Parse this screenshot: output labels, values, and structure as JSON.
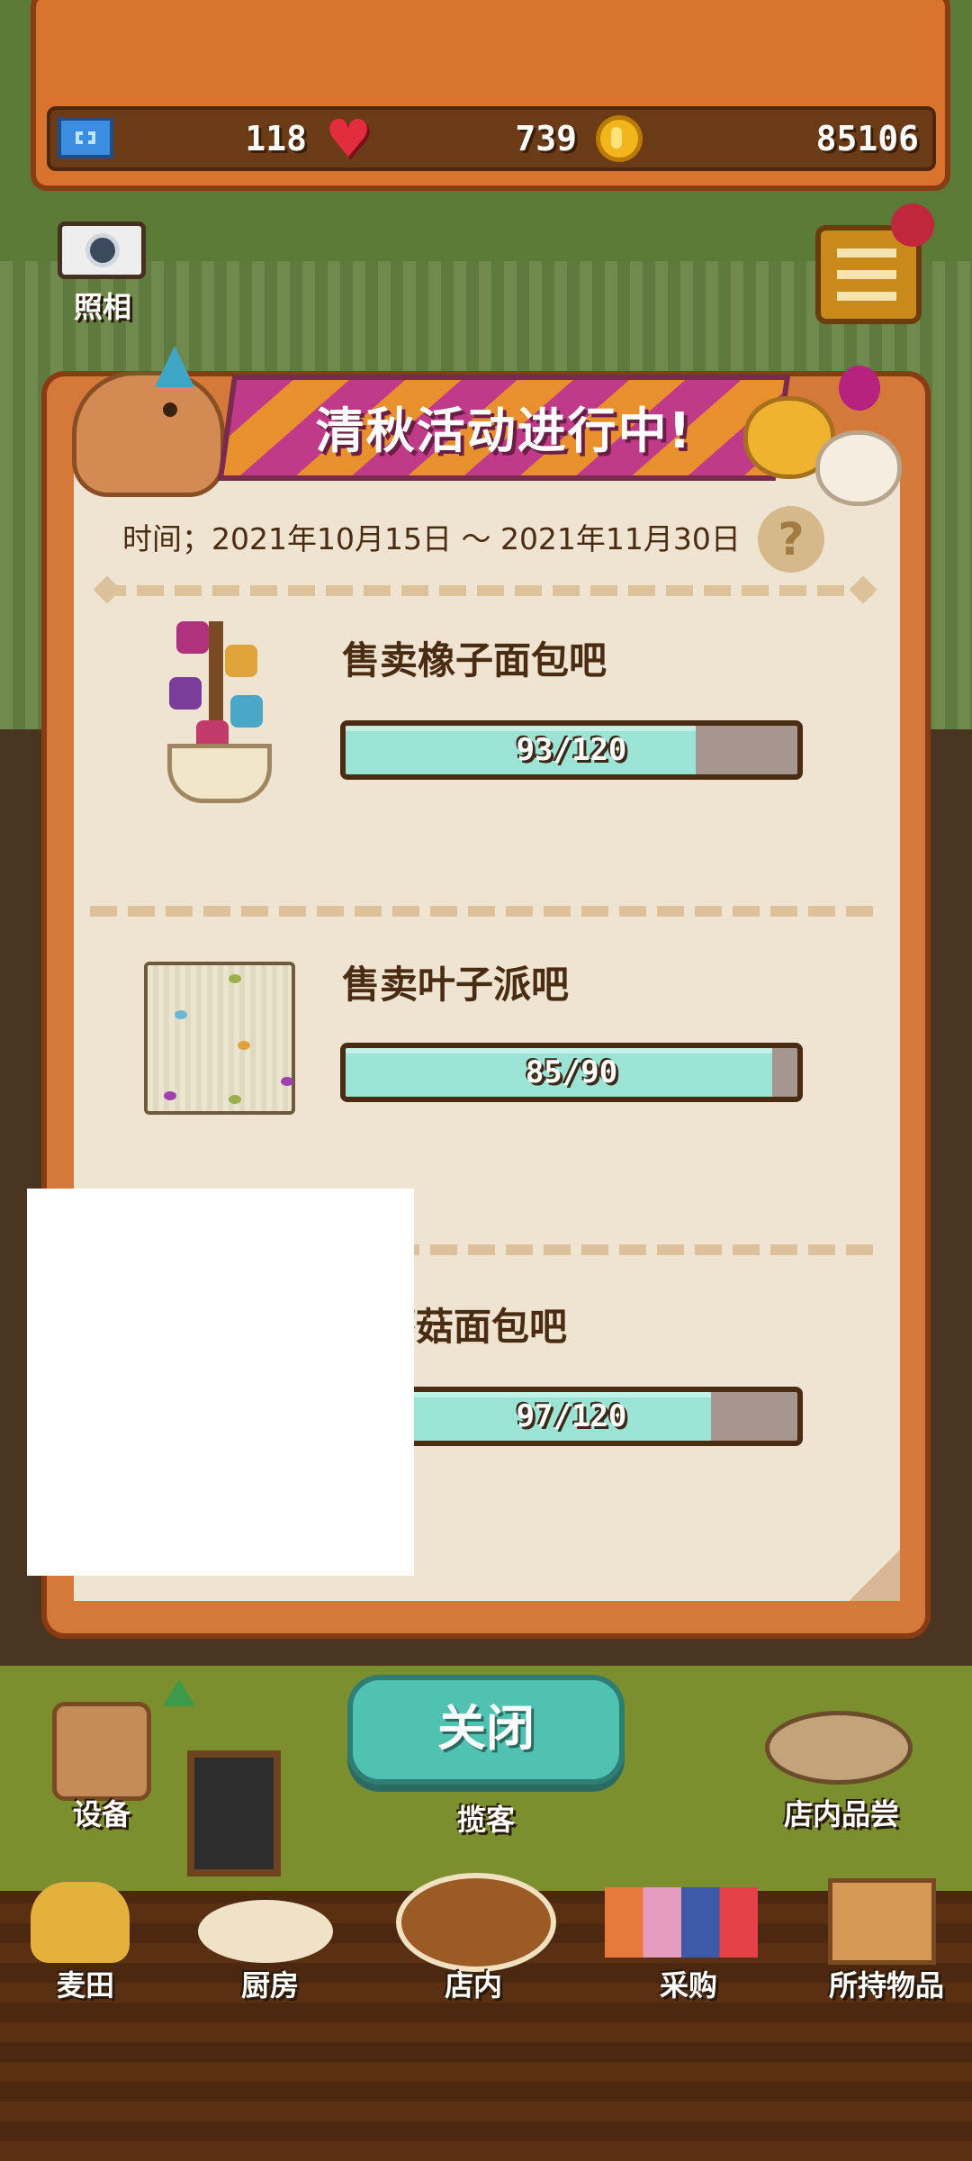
{
  "stats": {
    "tickets": "118",
    "hearts": "739",
    "coins": "85106"
  },
  "camera": {
    "label": "照相"
  },
  "event": {
    "title": "清秋活动进行中!",
    "date": "时间；2021年10月15日 ～ 2021年11月30日",
    "help_label": "?",
    "tasks": [
      {
        "name": "售卖橡子面包吧",
        "progress_text": "93/120",
        "current": 93,
        "total": 120
      },
      {
        "name": "售卖叶子派吧",
        "progress_text": "85/90",
        "current": 85,
        "total": 90
      },
      {
        "name": "蘑菇面包吧",
        "progress_text": "97/120",
        "current": 97,
        "total": 120
      }
    ]
  },
  "close_label": "关闭",
  "top_actions": {
    "equipment": "设备",
    "attract": "揽客",
    "tasting": "店内品尝"
  },
  "nav": [
    {
      "label": "麦田"
    },
    {
      "label": "厨房"
    },
    {
      "label": "店内"
    },
    {
      "label": "采购"
    },
    {
      "label": "所持物品"
    }
  ]
}
